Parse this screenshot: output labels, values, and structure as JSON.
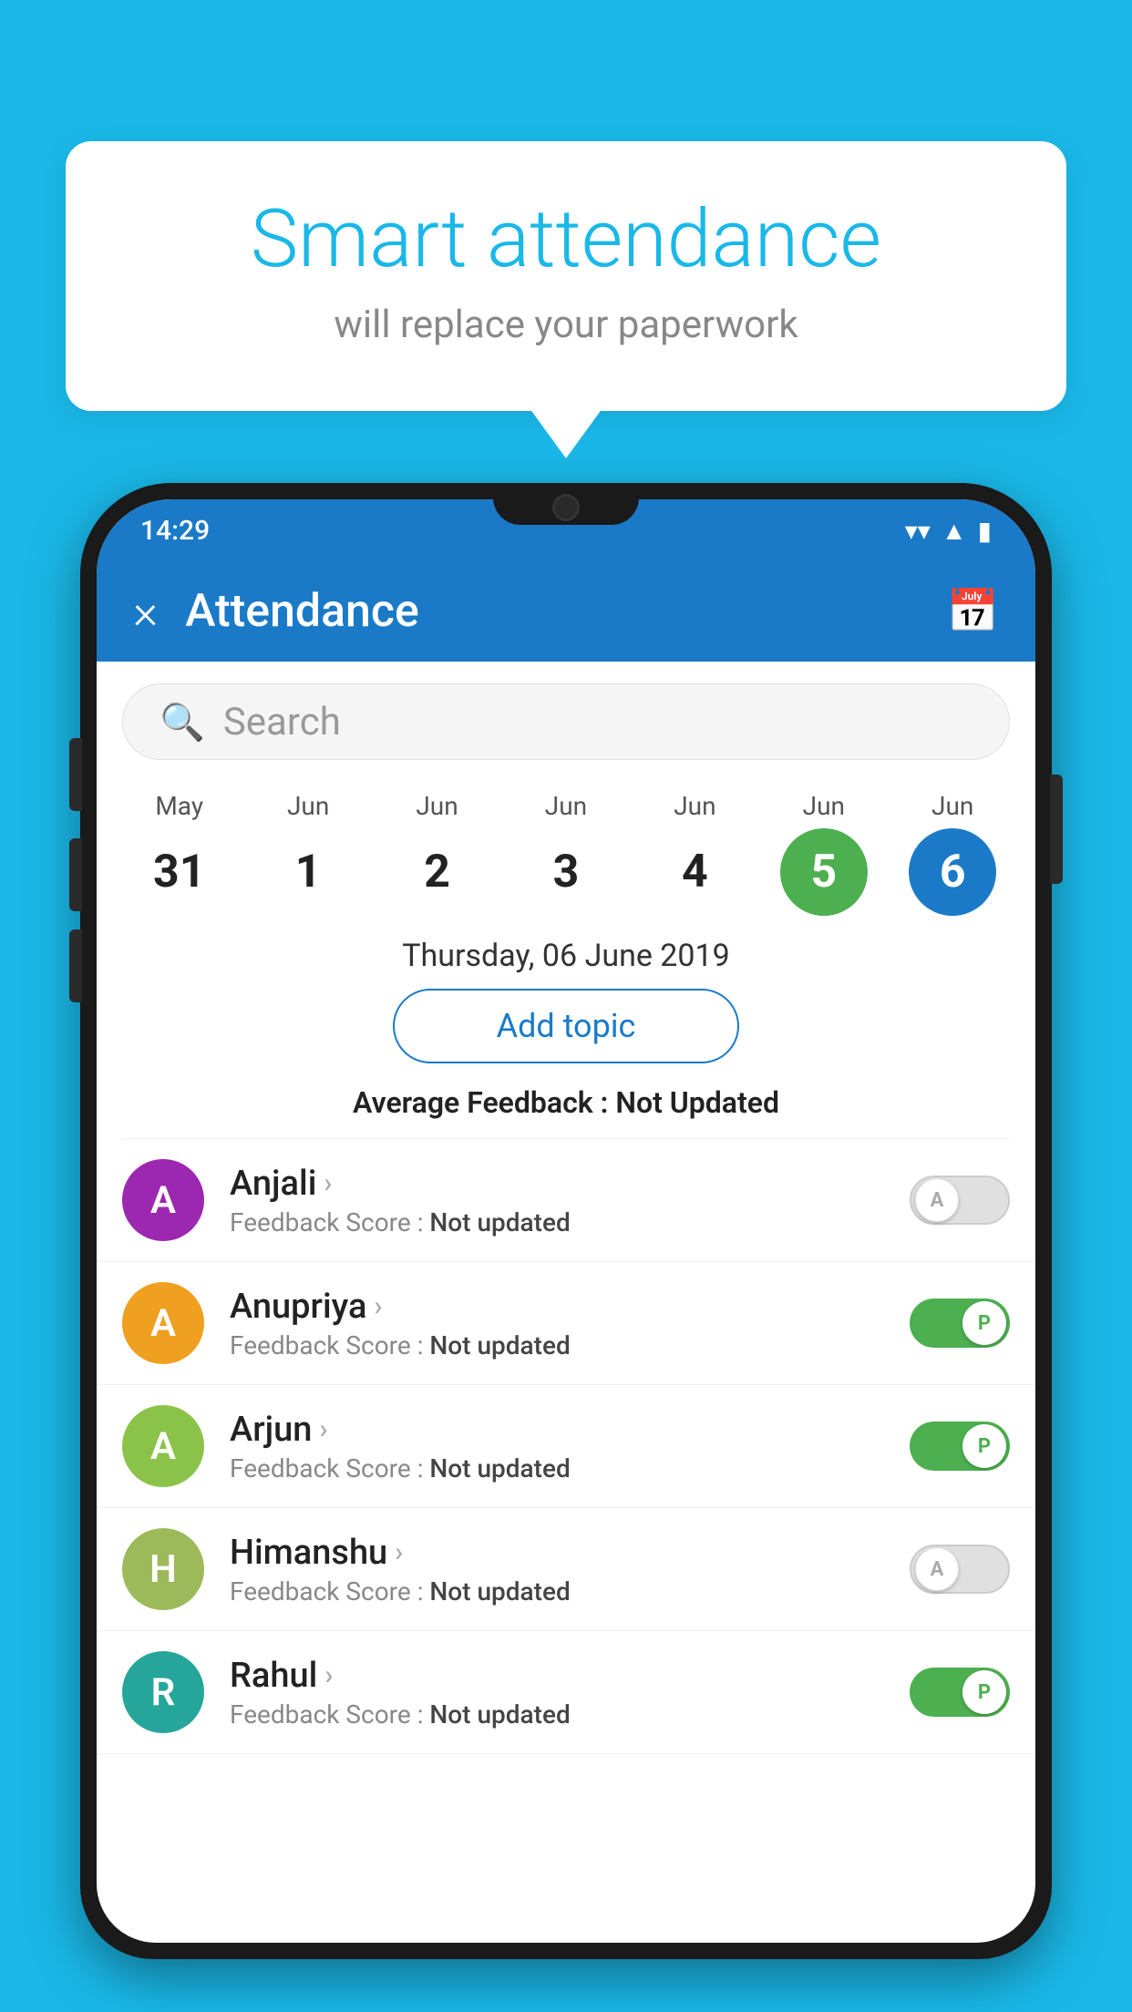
{
  "background_color": "#1ab8e8",
  "bubble": {
    "title": "Smart attendance",
    "subtitle": "will replace your paperwork"
  },
  "status_bar": {
    "time": "14:29",
    "icons": [
      "wifi",
      "signal",
      "battery"
    ]
  },
  "app_bar": {
    "title": "Attendance",
    "close_label": "×",
    "calendar_icon": "📅"
  },
  "search": {
    "placeholder": "Search"
  },
  "calendar": {
    "days": [
      {
        "month": "May",
        "date": "31",
        "state": "normal"
      },
      {
        "month": "Jun",
        "date": "1",
        "state": "normal"
      },
      {
        "month": "Jun",
        "date": "2",
        "state": "normal"
      },
      {
        "month": "Jun",
        "date": "3",
        "state": "normal"
      },
      {
        "month": "Jun",
        "date": "4",
        "state": "normal"
      },
      {
        "month": "Jun",
        "date": "5",
        "state": "today"
      },
      {
        "month": "Jun",
        "date": "6",
        "state": "selected"
      }
    ]
  },
  "selected_date": "Thursday, 06 June 2019",
  "add_topic_label": "Add topic",
  "average_feedback": {
    "label": "Average Feedback : ",
    "value": "Not Updated"
  },
  "students": [
    {
      "name": "Anjali",
      "avatar_letter": "A",
      "avatar_color": "purple",
      "feedback": "Feedback Score : ",
      "feedback_value": "Not updated",
      "toggle_state": "off",
      "toggle_label": "A"
    },
    {
      "name": "Anupriya",
      "avatar_letter": "A",
      "avatar_color": "yellow",
      "feedback": "Feedback Score : ",
      "feedback_value": "Not updated",
      "toggle_state": "on",
      "toggle_label": "P"
    },
    {
      "name": "Arjun",
      "avatar_letter": "A",
      "avatar_color": "green",
      "feedback": "Feedback Score : ",
      "feedback_value": "Not updated",
      "toggle_state": "on",
      "toggle_label": "P"
    },
    {
      "name": "Himanshu",
      "avatar_letter": "H",
      "avatar_color": "khaki",
      "feedback": "Feedback Score : ",
      "feedback_value": "Not updated",
      "toggle_state": "off",
      "toggle_label": "A"
    },
    {
      "name": "Rahul",
      "avatar_letter": "R",
      "avatar_color": "teal",
      "feedback": "Feedback Score : ",
      "feedback_value": "Not updated",
      "toggle_state": "on",
      "toggle_label": "P"
    }
  ]
}
